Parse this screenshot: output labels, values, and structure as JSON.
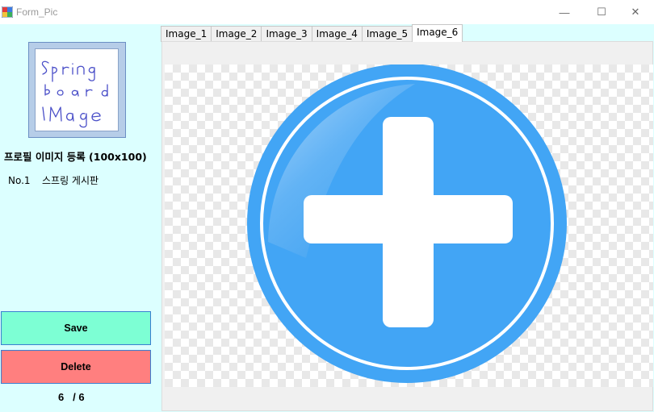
{
  "window": {
    "title": "Form_Pic",
    "minimize_glyph": "—",
    "maximize_glyph": "☐",
    "close_glyph": "✕"
  },
  "profile": {
    "image_text_lines": [
      "Spring",
      "board",
      "IMage"
    ],
    "caption": "프로필 이미지 등록 (100x100)",
    "number": "No.1",
    "name": "스프링 게시판"
  },
  "buttons": {
    "save": "Save",
    "delete": "Delete"
  },
  "pager": {
    "current": "6",
    "total": "6",
    "separator": "/"
  },
  "tabs": [
    {
      "label": "Image_1",
      "active": false
    },
    {
      "label": "Image_2",
      "active": false
    },
    {
      "label": "Image_3",
      "active": false
    },
    {
      "label": "Image_4",
      "active": false
    },
    {
      "label": "Image_5",
      "active": false
    },
    {
      "label": "Image_6",
      "active": true
    }
  ],
  "active_image": {
    "icon": "plus-circle-icon",
    "color": "#42a5f5",
    "background": "transparency-checkerboard"
  },
  "colors": {
    "panel_bg": "#dcffff",
    "save_bg": "#7dffd4",
    "delete_bg": "#ff7f7f"
  }
}
